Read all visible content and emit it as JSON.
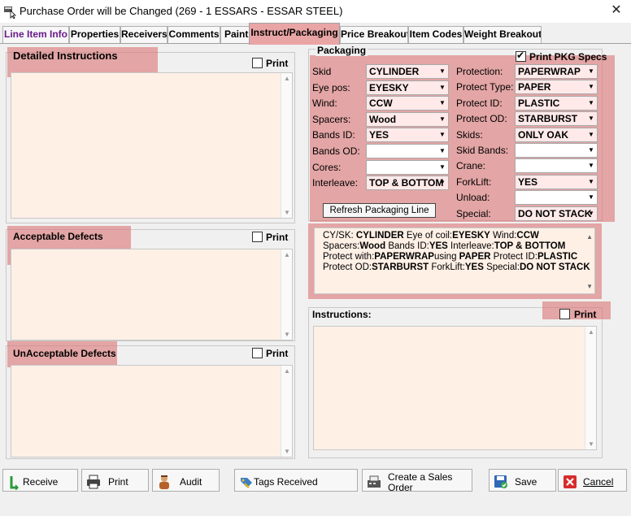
{
  "window": {
    "title": "Purchase Order will be Changed  (269 - 1  ESSARS -  ESSAR STEEL)",
    "close": "✕"
  },
  "tabs": [
    {
      "label": "Line Item Info"
    },
    {
      "label": "Properties"
    },
    {
      "label": "Receivers"
    },
    {
      "label": "Comments"
    },
    {
      "label": "Paint"
    },
    {
      "label": "Instruct/Packaging"
    },
    {
      "label": "Price Breakout"
    },
    {
      "label": "Item Codes"
    },
    {
      "label": "Weight Breakout"
    }
  ],
  "left": {
    "detailed": {
      "label": "Detailed Instructions",
      "print": "Print"
    },
    "acceptable": {
      "label": "Acceptable Defects",
      "print": "Print"
    },
    "unacceptable": {
      "label": "UnAcceptable Defects",
      "print": "Print"
    }
  },
  "packaging": {
    "group_label": "Packaging",
    "print_pkg_specs": "Print PKG Specs",
    "left_fields": [
      {
        "label": "Skid",
        "value": "CYLINDER"
      },
      {
        "label": "Eye pos:",
        "value": "EYESKY"
      },
      {
        "label": "Wind:",
        "value": "CCW"
      },
      {
        "label": "Spacers:",
        "value": "Wood"
      },
      {
        "label": "Bands ID:",
        "value": "YES"
      },
      {
        "label": "Bands OD:",
        "value": ""
      },
      {
        "label": "Cores:",
        "value": ""
      },
      {
        "label": "Interleave:",
        "value": "TOP & BOTTOM"
      }
    ],
    "right_fields": [
      {
        "label": "Protection:",
        "value": "PAPERWRAP"
      },
      {
        "label": "Protect Type:",
        "value": "PAPER"
      },
      {
        "label": "Protect ID:",
        "value": "PLASTIC"
      },
      {
        "label": "Protect OD:",
        "value": "STARBURST"
      },
      {
        "label": "Skids:",
        "value": "ONLY OAK"
      },
      {
        "label": "Skid Bands:",
        "value": ""
      },
      {
        "label": "Crane:",
        "value": ""
      },
      {
        "label": "ForkLift:",
        "value": "YES"
      },
      {
        "label": "Unload:",
        "value": ""
      },
      {
        "label": "Special:",
        "value": "DO NOT STACK"
      }
    ],
    "refresh_button": "Refresh Packaging Line"
  },
  "summary": {
    "l1a": "CY/SK: ",
    "l1b": "CYLINDER",
    "l1c": " Eye of coil:",
    "l1d": "EYESKY",
    "l1e": " Wind:",
    "l1f": "CCW",
    "l2a": "Spacers:",
    "l2b": "Wood",
    "l2c": " Bands ID:",
    "l2d": "YES",
    "l2e": " Interleave:",
    "l2f": "TOP & BOTTOM",
    "l3a": "Protect with:",
    "l3b": "PAPERWRAP",
    "l3c": "using ",
    "l3d": "PAPER",
    "l3e": " Protect ID:",
    "l3f": "PLASTIC",
    "l4a": "Protect OD:",
    "l4b": "STARBURST",
    "l4c": " ForkLift:",
    "l4d": "YES",
    "l4e": " Special:",
    "l4f": "DO NOT STACK"
  },
  "instructions": {
    "label": "Instructions:",
    "print": "Print"
  },
  "footer": {
    "receive": "Receive",
    "print": "Print",
    "audit": "Audit",
    "tags_received": "Tags Received",
    "create_sales_order_1": "Create a Sales",
    "create_sales_order_2": "Order",
    "save": "Save",
    "cancel": "Cancel"
  },
  "colors": {
    "highlight": "#dc7878",
    "textarea_bg": "#fff0e6",
    "purple_tab": "#6a1a8a"
  }
}
